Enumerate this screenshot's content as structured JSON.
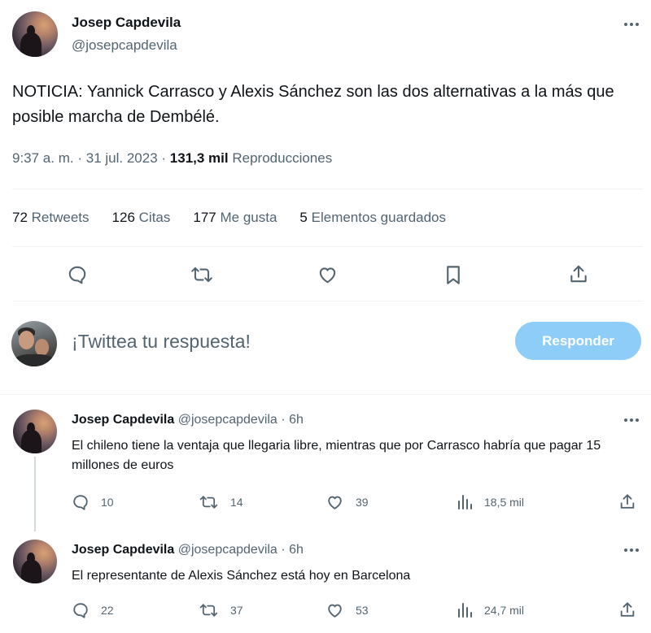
{
  "main_tweet": {
    "author_name": "Josep Capdevila",
    "author_handle": "@josepcapdevila",
    "text": "NOTICIA: Yannick Carrasco y Alexis Sánchez son las dos alternativas a la más que posible marcha de Dembélé.",
    "time": "9:37 a. m.",
    "date": "31 jul. 2023",
    "views_count": "131,3 mil",
    "views_label": "Reproducciones",
    "separator": "·",
    "stats": {
      "retweets_count": "72",
      "retweets_label": "Retweets",
      "quotes_count": "126",
      "quotes_label": "Citas",
      "likes_count": "177",
      "likes_label": "Me gusta",
      "bookmarks_count": "5",
      "bookmarks_label": "Elementos guardados"
    }
  },
  "composer": {
    "placeholder": "¡Twittea tu respuesta!",
    "reply_button": "Responder"
  },
  "replies": [
    {
      "author_name": "Josep Capdevila",
      "author_handle": "@josepcapdevila",
      "dot": "·",
      "time_ago": "6h",
      "text": "El chileno tiene la ventaja que llegaria libre, mientras que por Carrasco habría que pagar 15 millones de euros",
      "replies": "10",
      "retweets": "14",
      "likes": "39",
      "views": "18,5 mil"
    },
    {
      "author_name": "Josep Capdevila",
      "author_handle": "@josepcapdevila",
      "dot": "·",
      "time_ago": "6h",
      "text": "El representante de Alexis Sánchez está hoy en Barcelona",
      "replies": "22",
      "retweets": "37",
      "likes": "53",
      "views": "24,7 mil"
    }
  ],
  "colors": {
    "text": "#0f1419",
    "muted": "#536471",
    "divider": "#eff3f4",
    "reply_button": "#8ecdf7"
  }
}
